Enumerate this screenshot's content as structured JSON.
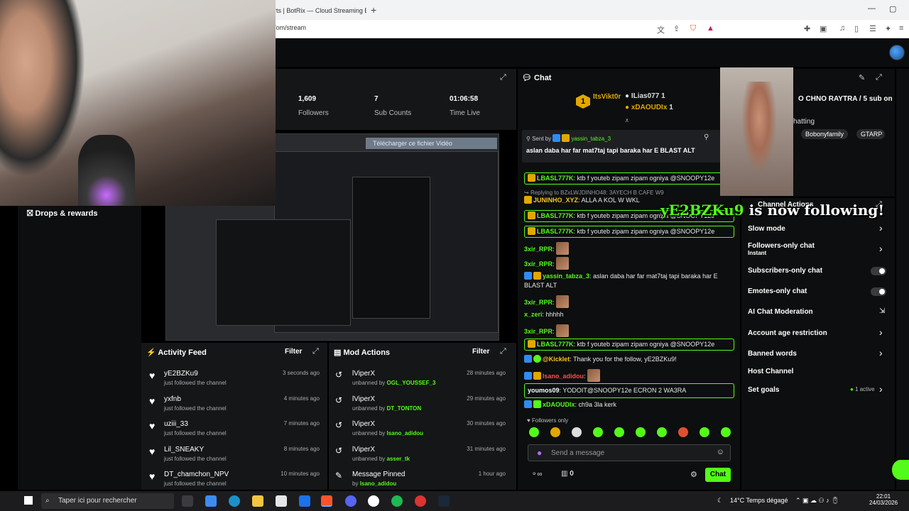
{
  "browser": {
    "tab_title": "rts | BotRix — Cloud Streaming B",
    "url": "/om/stream"
  },
  "stats": [
    {
      "value": "1,609",
      "label": "Followers"
    },
    {
      "value": "7",
      "label": "Sub Counts"
    },
    {
      "value": "01:06:58",
      "label": "Time Live"
    }
  ],
  "drops": {
    "label": "Drops & rewards"
  },
  "preview": {
    "download_bar": "Télécharger ce fichier Vidéo"
  },
  "activity_feed": {
    "title": "Activity Feed",
    "filter": "Filter",
    "items": [
      {
        "name": "yE2BZKu9",
        "sub": "just followed the channel",
        "time": "3 seconds ago"
      },
      {
        "name": "yxfnb",
        "sub": "just followed the channel",
        "time": "4 minutes ago"
      },
      {
        "name": "uziii_33",
        "sub": "just followed the channel",
        "time": "7 minutes ago"
      },
      {
        "name": "Lil_SNEAKY",
        "sub": "just followed the channel",
        "time": "8 minutes ago"
      },
      {
        "name": "DT_chamchon_NPV",
        "sub": "just followed the channel",
        "time": "10 minutes ago"
      }
    ]
  },
  "mod_actions": {
    "title": "Mod Actions",
    "filter": "Filter",
    "items": [
      {
        "name": "lViperX",
        "action": "unbanned by",
        "by": "OGL_YOUSSEF_3",
        "time": "28 minutes ago"
      },
      {
        "name": "lViperX",
        "action": "unbanned by",
        "by": "DT_TONTON",
        "time": "29 minutes ago"
      },
      {
        "name": "lViperX",
        "action": "unbanned by",
        "by": "lsano_adidou",
        "time": "30 minutes ago"
      },
      {
        "name": "lViperX",
        "action": "unbanned by",
        "by": "asser_tk",
        "time": "31 minutes ago"
      },
      {
        "name": "Message Pinned",
        "action": "by",
        "by": "lsano_adidou",
        "time": "1 hour ago"
      }
    ]
  },
  "chat": {
    "title": "Chat",
    "leaders": {
      "first": "ItsVikt0r",
      "first_count": "1",
      "second": "ILias077",
      "second_count": "1",
      "third": "xDAOUDIx",
      "third_count": "1"
    },
    "pinned": {
      "sent_by": "Sent by",
      "user": "yassin_tabza_3",
      "message": "aslan daba har far mat7taj tapi baraka har E BLAST ALT"
    },
    "messages": [
      {
        "user": "LBASL777K",
        "text": ": ktb f youteb zipam zipam ogniya @SNOOPY12e"
      },
      {
        "reply": "Replying to BZxLWJDINHO48: 3AYECH B CAFE W9"
      },
      {
        "user": "JUNINHO_XYZ",
        "text": ": ALLA A KOL W WKL"
      },
      {
        "user": "LBASL777K",
        "text": ": ktb f youteb zipam zipam ogniya @SNOOPY12e"
      },
      {
        "user": "LBASL777K",
        "text": ": ktb f youteb zipam zipam ogniya @SNOOPY12e"
      },
      {
        "user": "3xir_RPR",
        "text": ":"
      },
      {
        "user": "3xir_RPR",
        "text": ":"
      },
      {
        "user": "yassin_tabza_3",
        "text": ": aslan daba har far mat7taj tapi baraka har E BLAST ALT"
      },
      {
        "user": "3xir_RPR",
        "text": ":"
      },
      {
        "user": "x_zeri",
        "text": ": hhhhh"
      },
      {
        "user": "3xir_RPR",
        "text": ":"
      },
      {
        "user": "LBASL777K",
        "text": ": ktb f youteb zipam zipam ogniya @SNOOPY12e"
      },
      {
        "user": "@Kicklet",
        "text": ": Thank you for the follow, yE2BZKu9!"
      },
      {
        "user": "lsano_adidou",
        "text": ":"
      },
      {
        "user": "youmos09",
        "text": ": YODOIT@SNOOPY12e ECRON 2 WA3RA"
      },
      {
        "user": "xDAOUDIx",
        "text": ": ch9a 3la kerk"
      }
    ],
    "followers_only": "Followers only",
    "placeholder": "Send a message",
    "viewer_count": "0",
    "send": "Chat"
  },
  "stream_info": {
    "title": "O CHNO RAYTRA / 5 sub on",
    "category": "hatting",
    "tags": [
      "Bobonyfamily",
      "GTARP"
    ]
  },
  "follow_alert": {
    "name": "yE2BZKu9",
    "text": " is now following!"
  },
  "channel_actions": {
    "title": "Channel Actions",
    "items": [
      {
        "label": "Slow mode",
        "control": "chevron"
      },
      {
        "label": "Followers-only chat",
        "sub": "Instant",
        "control": "chevron"
      },
      {
        "label": "Subscribers-only chat",
        "control": "toggle"
      },
      {
        "label": "Emotes-only chat",
        "control": "toggle"
      },
      {
        "label": "AI Chat Moderation",
        "control": "external"
      },
      {
        "label": "Account age restriction",
        "control": "chevron"
      },
      {
        "label": "Banned words",
        "control": "chevron"
      },
      {
        "label": "Host Channel",
        "control": "none"
      },
      {
        "label": "Set goals",
        "badge": "1 active",
        "control": "chevron"
      }
    ]
  },
  "taskbar": {
    "search": "Taper ici pour rechercher",
    "weather": "14°C  Temps dégagé",
    "time": "22:01",
    "date": "24/03/2026"
  },
  "colors": {
    "accent": "#53fc18",
    "background": "#0d0e0f",
    "panel": "#151617"
  }
}
